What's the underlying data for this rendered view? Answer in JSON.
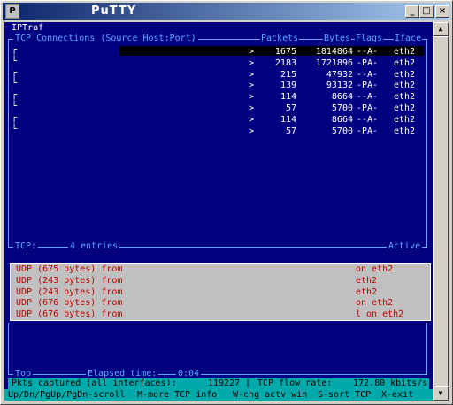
{
  "window": {
    "title": "PuTTY",
    "min_label": "_",
    "max_label": "□",
    "close_label": "×",
    "icon_label": "P"
  },
  "app_name": "IPTraf",
  "tcp_header": {
    "title": "TCP Connections (Source Host:Port)",
    "packets": "Packets",
    "bytes": "Bytes",
    "flags": "Flags",
    "iface": "Iface"
  },
  "tcp_rows": [
    {
      "packets": "1675",
      "bytes": "1814864",
      "flags": "--A-",
      "iface": "eth2"
    },
    {
      "packets": "2183",
      "bytes": "1721896",
      "flags": "-PA-",
      "iface": "eth2"
    },
    {
      "packets": "215",
      "bytes": "47932",
      "flags": "--A-",
      "iface": "eth2"
    },
    {
      "packets": "139",
      "bytes": "93132",
      "flags": "-PA-",
      "iface": "eth2"
    },
    {
      "packets": "114",
      "bytes": "8664",
      "flags": "--A-",
      "iface": "eth2"
    },
    {
      "packets": "57",
      "bytes": "5700",
      "flags": "-PA-",
      "iface": "eth2"
    },
    {
      "packets": "114",
      "bytes": "8664",
      "flags": "--A-",
      "iface": "eth2"
    },
    {
      "packets": "57",
      "bytes": "5700",
      "flags": "-PA-",
      "iface": "eth2"
    }
  ],
  "tcp_arrow": ">",
  "tcp_footer": {
    "label": "TCP:",
    "count": "4 entries",
    "state": "Active"
  },
  "udp_rows": [
    {
      "text": "UDP (675 bytes) from",
      "suffix": "on eth2"
    },
    {
      "text": "UDP (243 bytes) from",
      "suffix": "eth2"
    },
    {
      "text": "UDP (243 bytes) from",
      "suffix": "eth2"
    },
    {
      "text": "UDP (676 bytes) from",
      "suffix": "on eth2"
    },
    {
      "text": "UDP (676 bytes) from",
      "suffix": "l on eth2"
    }
  ],
  "bottom_info": {
    "top_label": "Top",
    "elapsed_label": "Elapsed time:",
    "elapsed_value": "0:04"
  },
  "status": {
    "pkts_label": "Pkts captured (all interfaces):",
    "pkts_value": "119227",
    "flow_label": "TCP flow rate:",
    "flow_value": "172.80 kbits/s"
  },
  "help": {
    "scroll": "Up/Dn/PgUp/PgDn-scroll",
    "more": "M-more TCP info",
    "chg": "W-chg actv win",
    "sort": "S-sort TCP",
    "exit": "X-exit"
  }
}
